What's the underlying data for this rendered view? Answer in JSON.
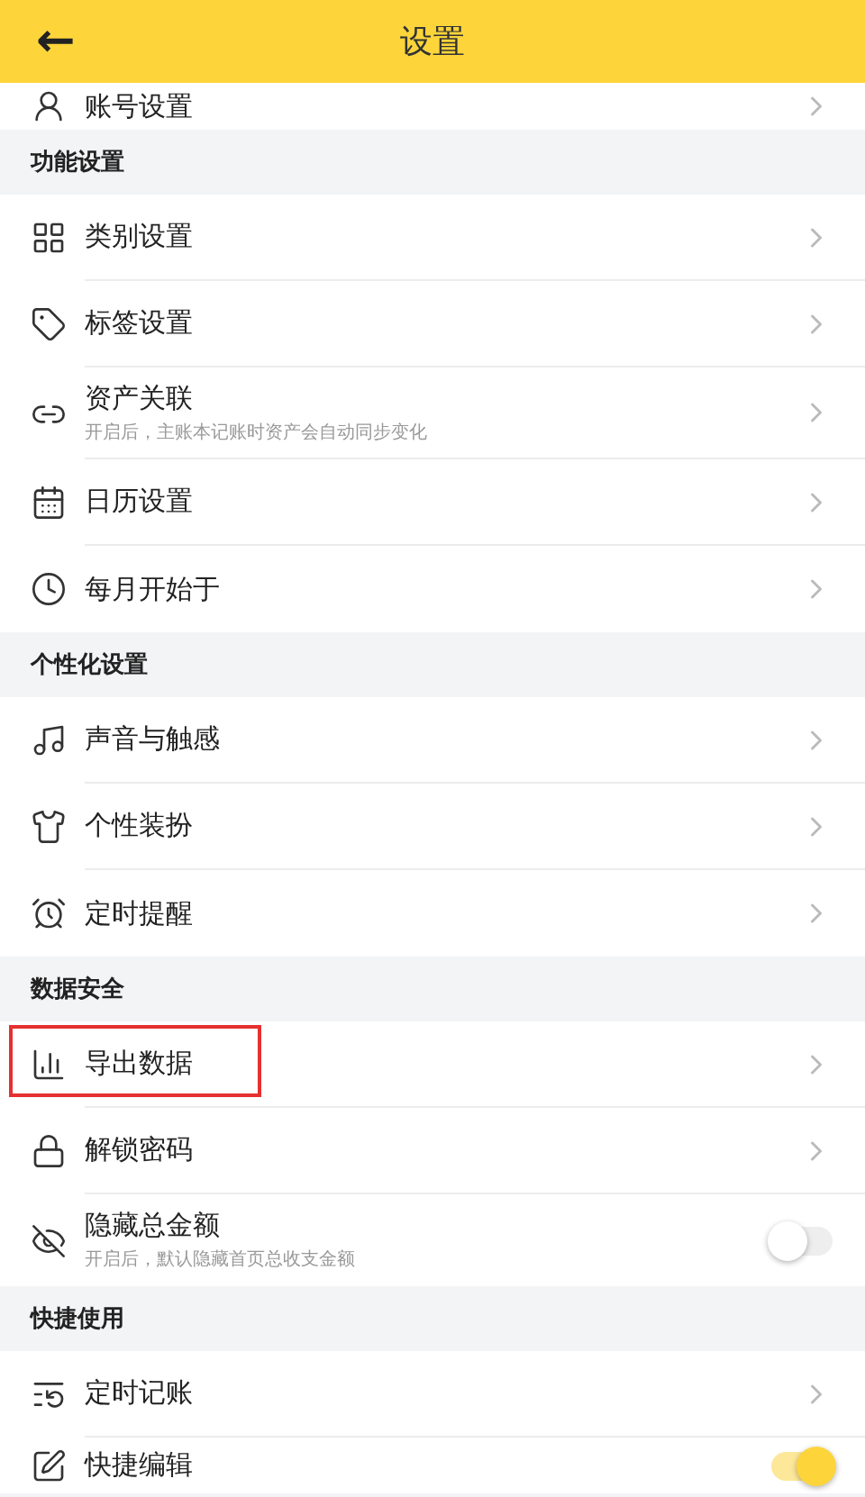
{
  "header": {
    "title": "设置",
    "back": "←"
  },
  "sections": [
    {
      "items": [
        {
          "label": "账号设置",
          "kind": "link"
        }
      ]
    },
    {
      "title": "功能设置",
      "items": [
        {
          "label": "类别设置",
          "kind": "link"
        },
        {
          "label": "标签设置",
          "kind": "link"
        },
        {
          "label": "资产关联",
          "sub": "开启后，主账本记账时资产会自动同步变化",
          "kind": "link"
        },
        {
          "label": "日历设置",
          "kind": "link"
        },
        {
          "label": "每月开始于",
          "kind": "link"
        }
      ]
    },
    {
      "title": "个性化设置",
      "items": [
        {
          "label": "声音与触感",
          "kind": "link"
        },
        {
          "label": "个性装扮",
          "kind": "link"
        },
        {
          "label": "定时提醒",
          "kind": "link"
        }
      ]
    },
    {
      "title": "数据安全",
      "items": [
        {
          "label": "导出数据",
          "kind": "link",
          "highlighted": true
        },
        {
          "label": "解锁密码",
          "kind": "link"
        },
        {
          "label": "隐藏总金额",
          "sub": "开启后，默认隐藏首页总收支金额",
          "kind": "toggle",
          "on": false
        }
      ]
    },
    {
      "title": "快捷使用",
      "items": [
        {
          "label": "定时记账",
          "kind": "link"
        },
        {
          "label": "快捷编辑",
          "kind": "toggle",
          "on": true
        }
      ]
    }
  ]
}
